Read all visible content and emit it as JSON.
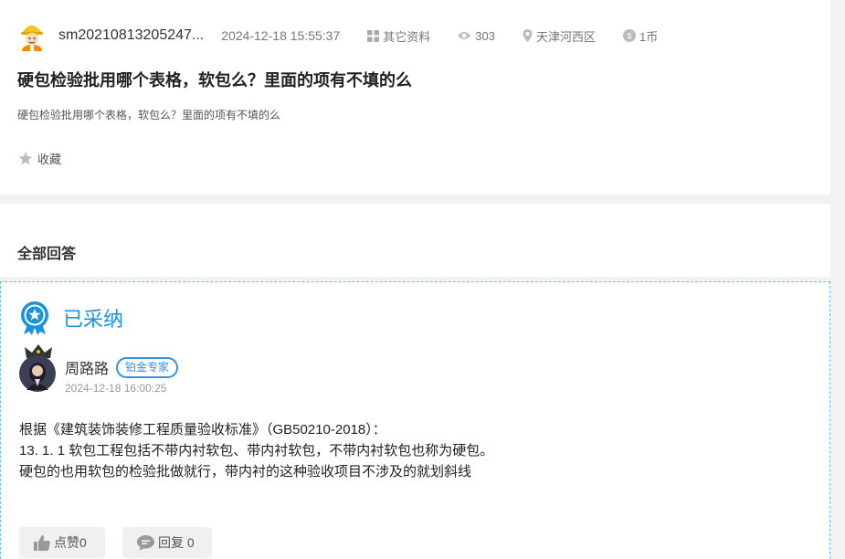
{
  "question": {
    "username": "sm20210813205247...",
    "datetime": "2024-12-18 15:55:37",
    "category": "其它资料",
    "views": "303",
    "location": "天津河西区",
    "reward": "1币",
    "title": "硬包检验批用哪个表格，软包么？里面的项有不填的么",
    "description": "硬包检验批用哪个表格，软包么？里面的项有不填的么",
    "favorite_label": "收藏"
  },
  "answers_header": {
    "title": "全部回答"
  },
  "answer": {
    "status": "已采纳",
    "author": "周路路",
    "badge": "铂金专家",
    "datetime": "2024-12-18 16:00:25",
    "body": [
      "根据《建筑装饰装修工程质量验收标准》（GB50210-2018）：",
      "13. 1. 1 软包工程包括不带内衬软包、带内衬软包，不带内衬软包也称为硬包。",
      "硬包的也用软包的检验批做就行，带内衬的这种验收项目不涉及的就划斜线"
    ],
    "like_label": "点赞0",
    "reply_label": "回复 0"
  },
  "colors": {
    "accent": "#1a92e0",
    "badge": "#3a8ee6",
    "dashed_border": "#6cc0ee"
  },
  "icons": [
    "worker-avatar",
    "grid-icon",
    "eye-icon",
    "pin-icon",
    "coin-icon",
    "star-icon",
    "award-medal-icon",
    "crown-icon",
    "thumb-up-icon",
    "comment-icon"
  ]
}
